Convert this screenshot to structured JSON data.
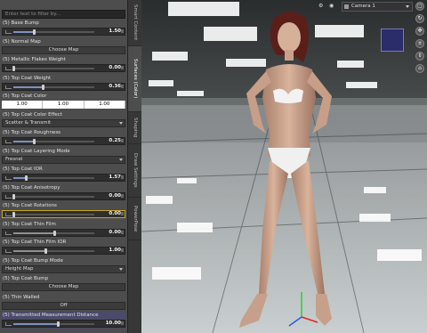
{
  "filter": {
    "placeholder": "Enter text to filter by..."
  },
  "properties": [
    {
      "label": "(5) Base Bump",
      "kind": "slider",
      "value": "1.50",
      "frac": 0.25
    },
    {
      "label": "(5) Normal Map",
      "kind": "button",
      "value": "Choose Map"
    },
    {
      "label": "(5) Metallic Flakes Weight",
      "kind": "slider",
      "value": "0.00",
      "frac": 0.0,
      "dim": true
    },
    {
      "label": "(5) Top Coat Weight",
      "kind": "slider",
      "value": "0.36",
      "frac": 0.36
    },
    {
      "label": "(5) Top Coat Color",
      "kind": "color",
      "values": [
        "1.00",
        "1.00",
        "1.00"
      ]
    },
    {
      "label": "(5) Top Coat Color Effect",
      "kind": "dropdown",
      "value": "Scatter & Transmit"
    },
    {
      "label": "(5) Top Coat Roughness",
      "kind": "slider",
      "value": "0.25",
      "frac": 0.25
    },
    {
      "label": "(5) Top Coat Layering Mode",
      "kind": "dropdown",
      "value": "Fresnel"
    },
    {
      "label": "(5) Top Coat IOR",
      "kind": "slider",
      "value": "1.57",
      "frac": 0.15
    },
    {
      "label": "(5) Top Coat Anisotropy",
      "kind": "slider",
      "value": "0.00",
      "frac": 0.0,
      "dim": true
    },
    {
      "label": "(5) Top Coat Rotations",
      "kind": "slider",
      "value": "0.00",
      "frac": 0.0,
      "highlight": true
    },
    {
      "label": "(5) Top Coat Thin Film",
      "kind": "slider",
      "value": "0.00",
      "frac": 0.5,
      "dim": true
    },
    {
      "label": "(5) Top Coat Thin Film IOR",
      "kind": "slider",
      "value": "1.00",
      "frac": 0.4,
      "dim": true
    },
    {
      "label": "(5) Top Coat Bump Mode",
      "kind": "dropdown",
      "value": "Height Map"
    },
    {
      "label": "(5) Top Coat Bump",
      "kind": "button",
      "value": "Choose Map"
    },
    {
      "label": "(5) Thin Walled",
      "kind": "button",
      "value": "Off"
    },
    {
      "label": "(5) Transmitted Measurement Distance",
      "kind": "slider",
      "value": "10.00",
      "frac": 0.55,
      "selected": true
    }
  ],
  "tabs": [
    "Smart Content",
    "Surfaces (Color)",
    "Shaping",
    "Draw Settings",
    "PowerPose"
  ],
  "viewport": {
    "camera": "Camera 1"
  },
  "colors": {
    "panel": "#4d4d4d",
    "slider_fill": "#7b93bd",
    "highlight": "#c8a42a"
  },
  "icons": [
    "checkbox-icon",
    "lock-icon",
    "camera-icon",
    "orbit-icon",
    "pan-icon",
    "zoom-icon",
    "frame-icon",
    "view-cube-icon",
    "gizmo-icon"
  ]
}
